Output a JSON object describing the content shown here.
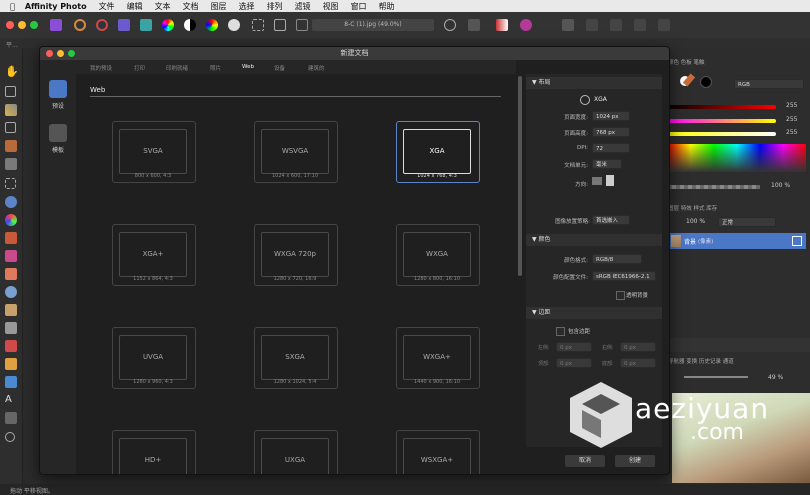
{
  "menubar": {
    "app_name": "Affinity Photo",
    "items": [
      "文件",
      "编辑",
      "文本",
      "文档",
      "图层",
      "选择",
      "排列",
      "滤镜",
      "视图",
      "窗口",
      "帮助"
    ]
  },
  "toolbar": {
    "document_title": "8-C (1).jpg (49.0%)"
  },
  "context_bar": {
    "text": "平..."
  },
  "dialog": {
    "title": "新建文档",
    "sidebar": [
      {
        "label": "预设",
        "icon": "preset-icon",
        "selected": true
      },
      {
        "label": "模板",
        "icon": "template-icon",
        "selected": false
      }
    ],
    "tabs": [
      "我的预设",
      "打印",
      "印刷就绪",
      "照片",
      "Web",
      "设备",
      "建筑的"
    ],
    "active_tab": "Web",
    "category_title": "Web",
    "presets": [
      {
        "name": "SVGA",
        "size": "800 x 600, 4:3",
        "selected": false
      },
      {
        "name": "WSVGA",
        "size": "1024 x 600, 17:10",
        "selected": false
      },
      {
        "name": "XGA",
        "size": "1024 x 768, 4:3",
        "selected": true
      },
      {
        "name": "XGA+",
        "size": "1152 x 864, 4:3",
        "selected": false
      },
      {
        "name": "WXGA 720p",
        "size": "1280 x 720, 16:9",
        "selected": false
      },
      {
        "name": "WXGA",
        "size": "1280 x 800, 16:10",
        "selected": false
      },
      {
        "name": "UVGA",
        "size": "1280 x 960, 4:3",
        "selected": false
      },
      {
        "name": "SXGA",
        "size": "1280 x 1024, 5:4",
        "selected": false
      },
      {
        "name": "WXGA+",
        "size": "1440 x 900, 16:10",
        "selected": false
      },
      {
        "name": "HD+",
        "size": "",
        "selected": false
      },
      {
        "name": "UXGA",
        "size": "",
        "selected": false
      },
      {
        "name": "WSXGA+",
        "size": "",
        "selected": false
      }
    ],
    "layout_section": {
      "title": "布局",
      "preset_name": "XGA",
      "page_width_label": "页面宽度:",
      "page_width": "1024 px",
      "page_height_label": "页面高度:",
      "page_height": "768 px",
      "dpi_label": "DPI:",
      "dpi": "72",
      "units_label": "文档单元:",
      "units": "毫米",
      "orientation_label": "方向:",
      "placement_label": "图像放置策略:",
      "placement": "首选嵌入"
    },
    "color_section": {
      "title": "颜色",
      "format_label": "颜色格式:",
      "format": "RGB/8",
      "profile_label": "颜色配置文件:",
      "profile": "sRGB IEC61966-2.1",
      "transparent_label": "透明背景"
    },
    "margins_section": {
      "title": "边距",
      "include_label": "包含边距",
      "left_label": "左侧:",
      "left": "0 px",
      "right_label": "右侧:",
      "right": "0 px",
      "top_label": "顶部:",
      "top": "0 px",
      "bottom_label": "底部:",
      "bottom": "0 px"
    },
    "cancel_label": "取消",
    "create_label": "创建"
  },
  "studio": {
    "top_tabs": "颜色 色板 笔触",
    "color_mode": "RGB",
    "r": "255",
    "g": "255",
    "b": "255",
    "opacity": "100 %",
    "layers_tabs": "图层 特效 样式 库存",
    "layer_opacity": "100 %",
    "blend_mode": "正常",
    "layer_name": "背景",
    "layer_note": "(像素)",
    "nav_tabs": "导航器 变换 历史记录 通道",
    "zoom": "49 %"
  },
  "status_bar": {
    "text": "拖动 平移视图。"
  },
  "watermark": {
    "text": "aeziyuan",
    "sub": ".com"
  },
  "colors": {
    "selection": "#5c84c8",
    "accent_blue": "#4a77c6"
  }
}
